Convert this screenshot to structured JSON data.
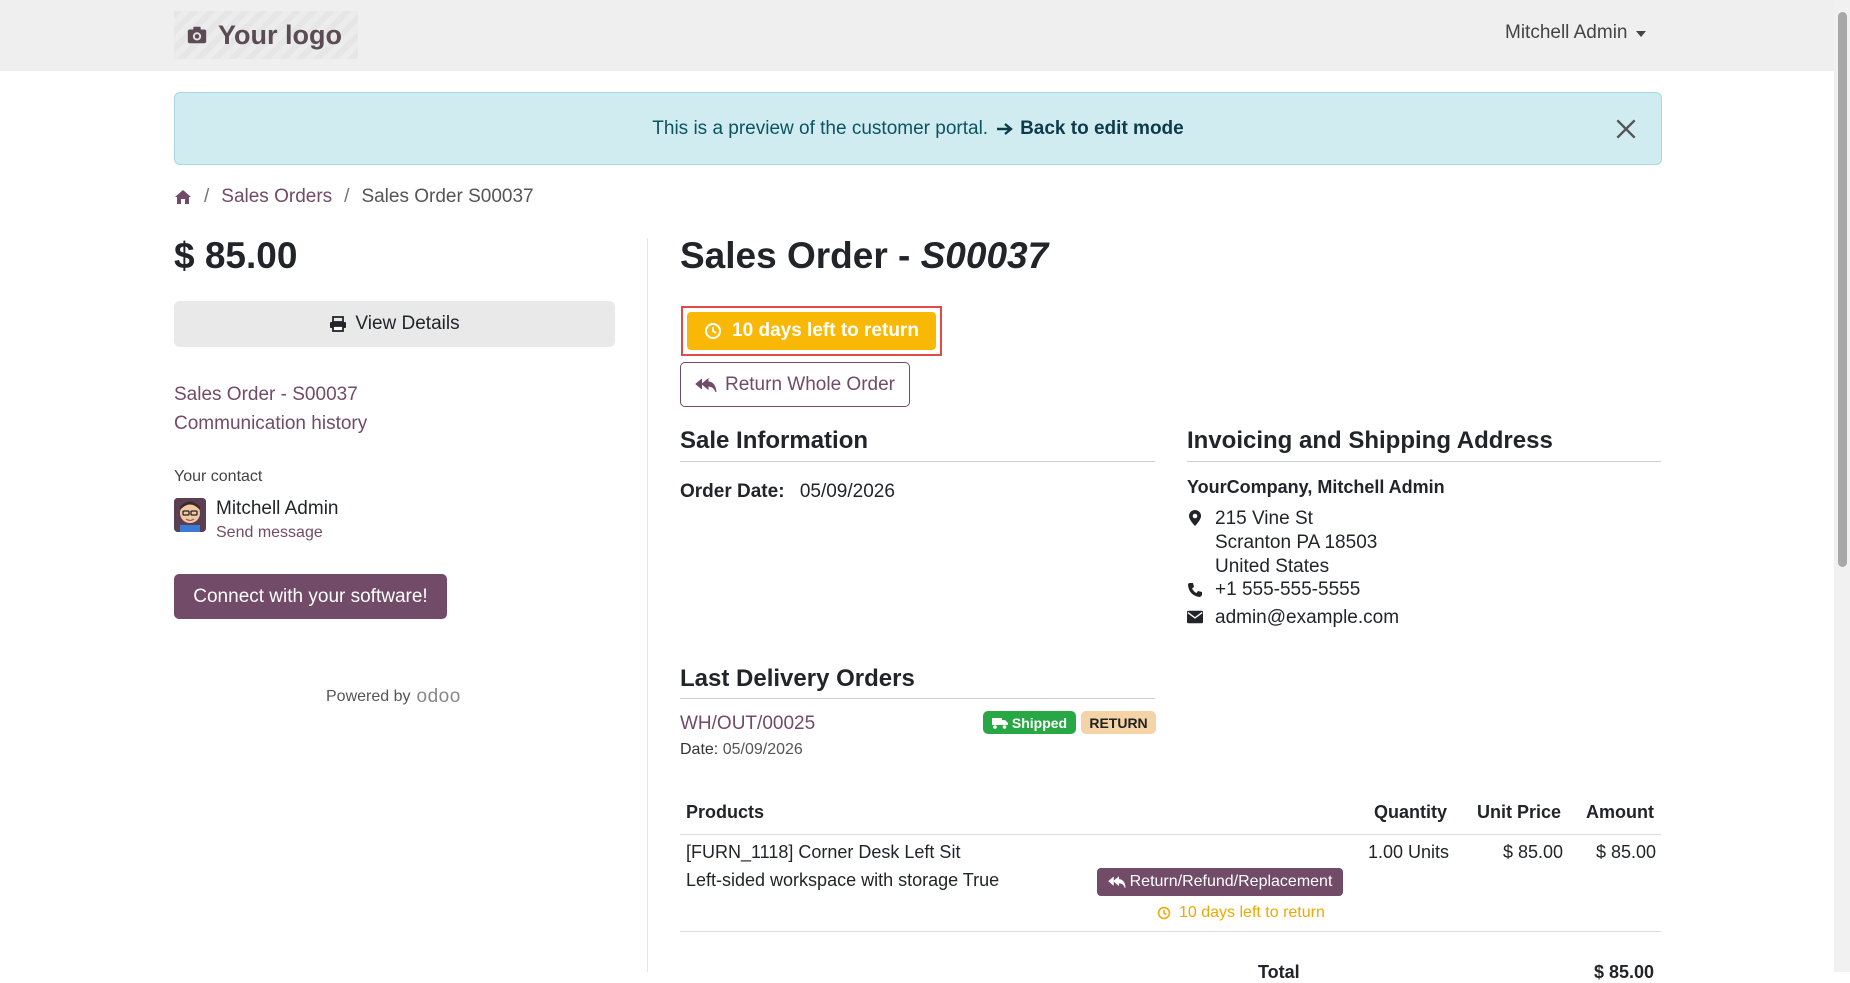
{
  "navbar": {
    "logo_text": "Your logo",
    "user_name": "Mitchell Admin"
  },
  "alert": {
    "message": "This is a preview of the customer portal.",
    "link_text": "Back to edit mode"
  },
  "breadcrumb": {
    "items": [
      "Sales Orders",
      "Sales Order S00037"
    ]
  },
  "sidebar": {
    "price": "$ 85.00",
    "view_details_label": "View Details",
    "links": [
      "Sales Order - S00037",
      "Communication history"
    ],
    "contact_label": "Your contact",
    "contact_name": "Mitchell Admin",
    "send_message": "Send message",
    "connect_label": "Connect with your software!",
    "powered_by": "Powered by",
    "powered_brand": "odoo"
  },
  "order": {
    "title_prefix": "Sales Order - ",
    "title_ref": "S00037",
    "return_days_label": "10 days left to return",
    "return_whole_label": "Return Whole Order"
  },
  "sale_info": {
    "title": "Sale Information",
    "order_date_label": "Order Date:",
    "order_date_value": "05/09/2026"
  },
  "address": {
    "title": "Invoicing and Shipping Address",
    "name": "YourCompany, Mitchell Admin",
    "street": "215 Vine St",
    "city": "Scranton PA 18503",
    "country": "United States",
    "phone": "+1 555-555-5555",
    "email": "admin@example.com"
  },
  "deliveries": {
    "title": "Last Delivery Orders",
    "items": [
      {
        "ref": "WH/OUT/00025",
        "date_label": "Date:",
        "date_value": "05/09/2026",
        "status_label": "Shipped",
        "return_label": "RETURN"
      }
    ]
  },
  "products_table": {
    "headers": [
      "Products",
      "Quantity",
      "Unit Price",
      "Amount"
    ],
    "rows": [
      {
        "name": "[FURN_1118] Corner Desk Left Sit",
        "description": "Left-sided workspace with storage True",
        "action_label": "Return/Refund/Replacement",
        "return_note": "10 days left to return",
        "quantity": "1.00 Units",
        "unit_price": "$ 85.00",
        "amount": "$ 85.00"
      }
    ],
    "total_label": "Total",
    "total_value": "$ 85.00"
  },
  "colors": {
    "brand": "#714B67",
    "warning": "#f9b806",
    "success": "#28a745",
    "alert_bg": "#d1ecf1"
  },
  "icons": [
    "camera-icon",
    "caret-down-icon",
    "close-icon",
    "home-icon",
    "printer-icon",
    "clock-icon",
    "reply-all-icon",
    "map-marker-icon",
    "phone-icon",
    "envelope-icon",
    "truck-icon"
  ]
}
